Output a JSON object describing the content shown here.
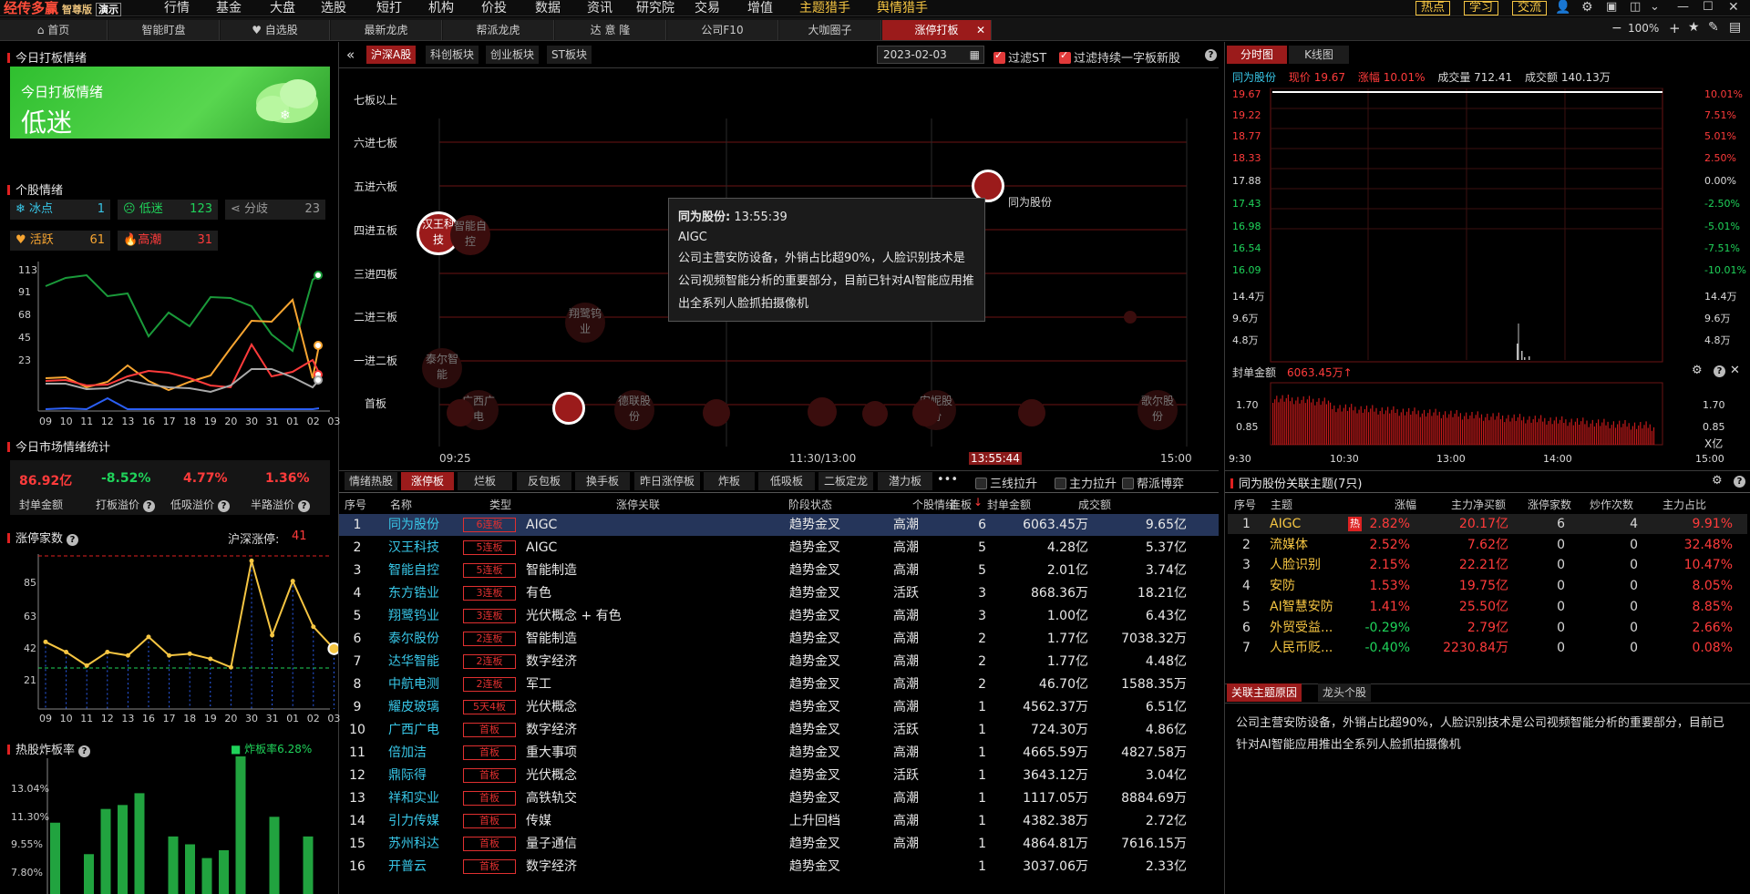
{
  "app": {
    "name": "经传多赢",
    "edition": "智尊版",
    "demo": "演示"
  },
  "menu": [
    "行情",
    "基金",
    "大盘",
    "选股",
    "短打",
    "机构",
    "价投",
    "数据",
    "资讯",
    "研究院",
    "交易",
    "增值",
    "主题猎手",
    "舆情猎手"
  ],
  "top_buttons": [
    "热点",
    "学习",
    "交流"
  ],
  "zoom": "100%",
  "tabs": [
    "首页",
    "智能盯盘",
    "自选股",
    "最新龙虎",
    "帮派龙虎",
    "达 意 隆",
    "公司F10",
    "大咖圈子",
    "涨停打板"
  ],
  "left": {
    "mood_title": "今日打板情绪",
    "mood_card_title": "今日打板情绪",
    "mood_value": "低迷",
    "stock_mood_title": "个股情绪",
    "moods": [
      {
        "label": "冰点",
        "count": "1"
      },
      {
        "label": "低迷",
        "count": "123"
      },
      {
        "label": "分歧",
        "count": "23"
      },
      {
        "label": "活跃",
        "count": "61"
      },
      {
        "label": "高潮",
        "count": "31"
      }
    ],
    "mood_y_ticks": [
      "113",
      "91",
      "68",
      "45",
      "23"
    ],
    "mood_x_ticks": [
      "09",
      "10",
      "11",
      "12",
      "13",
      "16",
      "17",
      "18",
      "19",
      "20",
      "30",
      "31",
      "01",
      "02",
      "03"
    ],
    "market_title": "今日市场情绪统计",
    "market_stats": [
      {
        "value": "86.92亿",
        "label": "封单金额"
      },
      {
        "value": "-8.52%",
        "label": "打板溢价"
      },
      {
        "value": "4.77%",
        "label": "低吸溢价"
      },
      {
        "value": "1.36%",
        "label": "半路溢价"
      }
    ],
    "limit_count_title": "涨停家数",
    "limit_count_sub": "沪深涨停:",
    "limit_count_val": "41",
    "limit_y_ticks": [
      "85",
      "63",
      "42",
      "21"
    ],
    "limit_values": [
      44,
      38,
      30,
      38,
      36,
      47,
      36,
      37,
      34,
      29,
      92,
      48,
      80,
      53,
      40
    ],
    "burst_title": "热股炸板率",
    "burst_legend": "炸板率6.28%",
    "burst_y_ticks": [
      "13.04%",
      "11.30%",
      "9.55%",
      "7.80%"
    ],
    "burst_values": [
      9.7,
      0,
      8.1,
      10.4,
      10.6,
      11.2,
      0,
      9.0,
      8.6,
      7.9,
      8.3,
      13.6,
      0,
      10.0,
      0,
      9.0
    ]
  },
  "center": {
    "market_tabs": [
      "沪深A股",
      "科创板块",
      "创业板块",
      "ST板块"
    ],
    "date": "2023-02-03",
    "filter_st": "过滤ST",
    "filter_yizi": "过滤持续一字板新股",
    "ladder_levels": [
      "七板以上",
      "六进七板",
      "五进六板",
      "四进五板",
      "三进四板",
      "二进三板",
      "一进二板",
      "首板"
    ],
    "time_ticks": [
      "09:25",
      "11:30/13:00",
      "13:55:44",
      "15:00"
    ],
    "bubbles": {
      "tongwei": "同为股份",
      "hanwang": "汉王科技",
      "zhineng": "智能自控",
      "xiangluo": "翔鹭钨业",
      "taier": "泰尔智能",
      "guangxi": "广西广电",
      "liantong": "德联股份",
      "anni": "安妮股份",
      "xiaoer": "歌尔股份"
    },
    "tooltip": {
      "name": "同为股份:",
      "time": "13:55:39",
      "theme": "AIGC",
      "desc": "公司主营安防设备，外销占比超90%，人脸识别技术是公司视频智能分析的重要部分，目前已针对AI智能应用推出全系列人脸抓拍摄像机"
    },
    "list_tabs": [
      "情绪热股",
      "涨停板",
      "烂板",
      "反包板",
      "换手板",
      "昨日涨停板",
      "炸板",
      "低吸板",
      "二板定龙",
      "潜力板"
    ],
    "list_checks": [
      "三线拉升",
      "主力拉升",
      "帮派博弈"
    ],
    "columns": [
      "序号",
      "名称",
      "类型",
      "涨停关联",
      "阶段状态",
      "个股情绪",
      "连板",
      "封单金额",
      "成交额"
    ],
    "rows": [
      [
        "1",
        "同为股份",
        "6连板",
        "AIGC",
        "趋势金叉",
        "高潮",
        "6",
        "6063.45万",
        "9.65亿"
      ],
      [
        "2",
        "汉王科技",
        "5连板",
        "AIGC",
        "趋势金叉",
        "高潮",
        "5",
        "4.28亿",
        "5.37亿"
      ],
      [
        "3",
        "智能自控",
        "5连板",
        "智能制造",
        "趋势金叉",
        "高潮",
        "5",
        "2.01亿",
        "3.74亿"
      ],
      [
        "4",
        "东方锆业",
        "3连板",
        "有色",
        "趋势金叉",
        "活跃",
        "3",
        "868.36万",
        "18.21亿"
      ],
      [
        "5",
        "翔鹭钨业",
        "3连板",
        "光伏概念 + 有色",
        "趋势金叉",
        "高潮",
        "3",
        "1.00亿",
        "6.43亿"
      ],
      [
        "6",
        "泰尔股份",
        "2连板",
        "智能制造",
        "趋势金叉",
        "高潮",
        "2",
        "1.77亿",
        "7038.32万"
      ],
      [
        "7",
        "达华智能",
        "2连板",
        "数字经济",
        "趋势金叉",
        "高潮",
        "2",
        "1.77亿",
        "4.48亿"
      ],
      [
        "8",
        "中航电测",
        "2连板",
        "军工",
        "趋势金叉",
        "高潮",
        "2",
        "46.70亿",
        "1588.35万"
      ],
      [
        "9",
        "耀皮玻璃",
        "5天4板",
        "光伏概念",
        "趋势金叉",
        "高潮",
        "1",
        "4562.37万",
        "6.51亿"
      ],
      [
        "10",
        "广西广电",
        "首板",
        "数字经济",
        "趋势金叉",
        "活跃",
        "1",
        "724.30万",
        "4.86亿"
      ],
      [
        "11",
        "倍加洁",
        "首板",
        "重大事项",
        "趋势金叉",
        "高潮",
        "1",
        "4665.59万",
        "4827.58万"
      ],
      [
        "12",
        "鼎际得",
        "首板",
        "光伏概念",
        "趋势金叉",
        "活跃",
        "1",
        "3643.12万",
        "3.04亿"
      ],
      [
        "13",
        "祥和实业",
        "首板",
        "高铁轨交",
        "趋势金叉",
        "高潮",
        "1",
        "1117.05万",
        "8884.69万"
      ],
      [
        "14",
        "引力传媒",
        "首板",
        "传媒",
        "上升回档",
        "高潮",
        "1",
        "4382.38万",
        "2.72亿"
      ],
      [
        "15",
        "苏州科达",
        "首板",
        "量子通信",
        "趋势金叉",
        "高潮",
        "1",
        "4864.81万",
        "7616.15万"
      ],
      [
        "16",
        "开普云",
        "首板",
        "数字经济",
        "趋势金叉",
        "",
        "1",
        "3037.06万",
        "2.33亿"
      ]
    ]
  },
  "right": {
    "chart_tabs": [
      "分时图",
      "K线图"
    ],
    "quote": {
      "name": "同为股份",
      "price_label": "现价",
      "price": "19.67",
      "chg_label": "涨幅",
      "chg": "10.01%",
      "vol_label": "成交量",
      "vol": "712.41",
      "amt_label": "成交额",
      "amt": "140.13万"
    },
    "price_ticks_left": [
      "19.67",
      "19.22",
      "18.77",
      "18.33",
      "17.88",
      "17.43",
      "16.98",
      "16.54",
      "16.09",
      "14.4万",
      "9.6万",
      "4.8万"
    ],
    "price_ticks_right": [
      "10.01%",
      "7.51%",
      "5.01%",
      "2.50%",
      "0.00%",
      "-2.50%",
      "-5.01%",
      "-7.51%",
      "-10.01%",
      "14.4万",
      "9.6万",
      "4.8万"
    ],
    "seal_title": "封单金额",
    "seal_value": "6063.45万",
    "seal_ticks": [
      "1.70",
      "0.85"
    ],
    "seal_unit": "X亿",
    "time_ticks": [
      "9:30",
      "10:30",
      "13:00",
      "14:00",
      "15:00"
    ],
    "theme_title": "同为股份关联主题(7只)",
    "theme_columns": [
      "序号",
      "主题",
      "涨幅",
      "主力净买额",
      "涨停家数",
      "炒作次数",
      "主力占比"
    ],
    "theme_hot": "热",
    "themes": [
      [
        "1",
        "AIGC",
        "2.82%",
        "20.17亿",
        "6",
        "4",
        "9.91%"
      ],
      [
        "2",
        "流媒体",
        "2.52%",
        "7.62亿",
        "0",
        "0",
        "32.48%"
      ],
      [
        "3",
        "人脸识别",
        "2.15%",
        "22.21亿",
        "0",
        "0",
        "10.47%"
      ],
      [
        "4",
        "安防",
        "1.53%",
        "19.75亿",
        "0",
        "0",
        "8.05%"
      ],
      [
        "5",
        "AI智慧安防",
        "1.41%",
        "25.50亿",
        "0",
        "0",
        "8.85%"
      ],
      [
        "6",
        "外贸受益...",
        "-0.29%",
        "2.79亿",
        "0",
        "0",
        "2.66%"
      ],
      [
        "7",
        "人民币贬...",
        "-0.40%",
        "2230.84万",
        "0",
        "0",
        "0.08%"
      ]
    ],
    "reason_tabs": [
      "关联主题原因",
      "龙头个股"
    ],
    "reason_text": "公司主营安防设备，外销占比超90%，人脸识别技术是公司视频智能分析的重要部分，目前已针对AI智能应用推出全系列人脸抓拍摄像机"
  }
}
